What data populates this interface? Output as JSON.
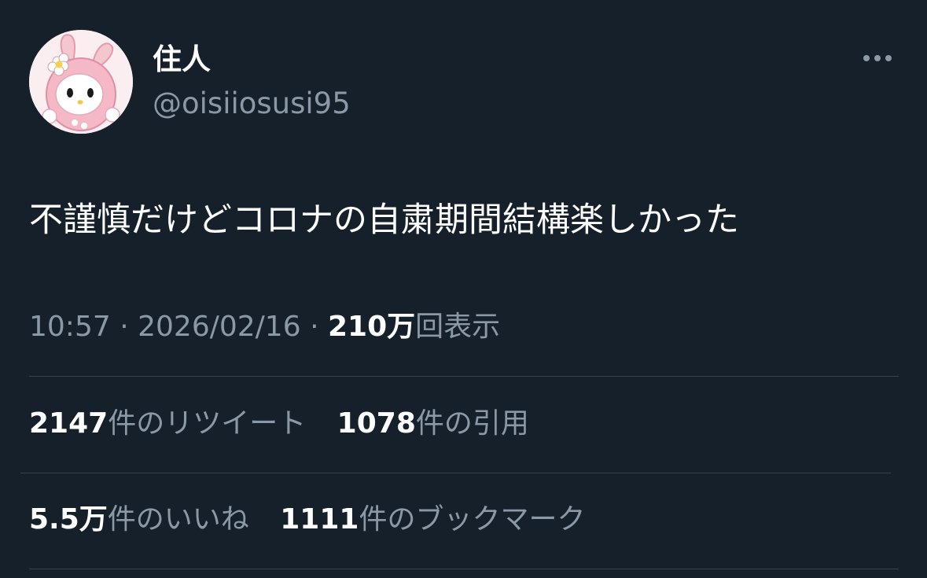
{
  "user": {
    "display_name": "住人",
    "handle": "@oisiiosusi95",
    "avatar_icon": "pink-bunny-hood-character-avatar"
  },
  "more_icon": "more-options-dots-icon",
  "tweet": {
    "text": "不謹慎だけどコロナの自粛期間結構楽しかった"
  },
  "meta": {
    "time": "10:57",
    "separator": "·",
    "date": "2026/02/16",
    "views_number": "210万",
    "views_label": "回表示"
  },
  "stats": {
    "retweets_number": "2147",
    "retweets_label": "件のリツイート",
    "quotes_number": "1078",
    "quotes_label": "件の引用",
    "likes_number": "5.5万",
    "likes_label": "件のいいね",
    "bookmarks_number": "1111",
    "bookmarks_label": "件のブックマーク"
  },
  "colors": {
    "background": "#15202b",
    "primary_text": "#ffffff",
    "secondary_text": "#8b98a5",
    "divider": "#38444d"
  }
}
